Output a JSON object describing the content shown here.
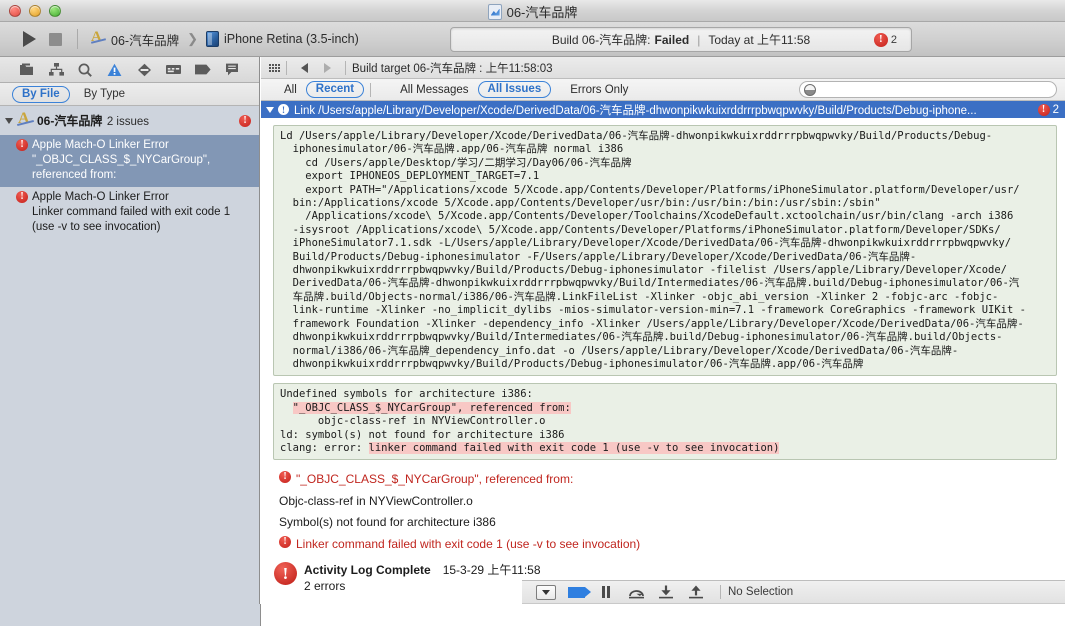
{
  "window": {
    "title": "06-汽车品牌",
    "traffic_lights": [
      "close-button",
      "minimize-button",
      "zoom-button"
    ]
  },
  "toolbar": {
    "run_label": "Run",
    "stop_label": "Stop",
    "scheme_name": "06-汽车品牌",
    "destination": "iPhone Retina (3.5-inch)",
    "status_prefix": "Build 06-汽车品牌:",
    "status_result": "Failed",
    "status_separator": "|",
    "status_time": "Today at 上午11:58",
    "error_count": "2"
  },
  "navigator": {
    "tabs": [
      {
        "name": "project-navigator",
        "selected": false
      },
      {
        "name": "symbol-navigator",
        "selected": false
      },
      {
        "name": "search-navigator",
        "selected": false
      },
      {
        "name": "issue-navigator",
        "selected": true
      },
      {
        "name": "test-navigator",
        "selected": false
      },
      {
        "name": "debug-navigator",
        "selected": false
      },
      {
        "name": "breakpoint-navigator",
        "selected": false
      },
      {
        "name": "log-navigator",
        "selected": false
      }
    ],
    "filter": {
      "by_file": "By File",
      "by_type": "By Type",
      "selected": "By File"
    },
    "group": {
      "title": "06-汽车品牌",
      "subtitle": "2 issues",
      "badge": "!"
    },
    "issues": [
      {
        "title": "Apple Mach-O Linker Error",
        "detail": "\"_OBJC_CLASS_$_NYCarGroup\", referenced from:",
        "selected": true,
        "badge": "!"
      },
      {
        "title": "Apple Mach-O Linker Error",
        "detail": "Linker command failed with exit code 1 (use -v to see invocation)",
        "selected": false,
        "badge": "!"
      }
    ]
  },
  "log": {
    "toolbar": {
      "grid_label": "Toggle Navigator",
      "back_label": "Back",
      "forward_label": "Forward",
      "breadcrumb": "Build target 06-汽车品牌 : 上午11:58:03"
    },
    "filters": {
      "all": "All",
      "recent": "Recent",
      "all_messages": "All Messages",
      "all_issues": "All Issues",
      "errors_only": "Errors Only",
      "selected_scope": "Recent",
      "selected_level": "All Issues"
    },
    "search_placeholder": "",
    "banner": {
      "label": "Link /Users/apple/Library/Developer/Xcode/DerivedData/06-汽车品牌-dhwonpikwkuixrddrrrpbwqpwvky/Build/Products/Debug-iphone...",
      "badge": "!",
      "count": "2"
    },
    "command_block": "Ld /Users/apple/Library/Developer/Xcode/DerivedData/06-汽车品牌-dhwonpikwkuixrddrrrpbwqpwvky/Build/Products/Debug-\n  iphonesimulator/06-汽车品牌.app/06-汽车品牌 normal i386\n    cd /Users/apple/Desktop/学习/二期学习/Day06/06-汽车品牌\n    export IPHONEOS_DEPLOYMENT_TARGET=7.1\n    export PATH=\"/Applications/xcode 5/Xcode.app/Contents/Developer/Platforms/iPhoneSimulator.platform/Developer/usr/\n  bin:/Applications/xcode 5/Xcode.app/Contents/Developer/usr/bin:/usr/bin:/bin:/usr/sbin:/sbin\"\n    /Applications/xcode\\ 5/Xcode.app/Contents/Developer/Toolchains/XcodeDefault.xctoolchain/usr/bin/clang -arch i386\n  -isysroot /Applications/xcode\\ 5/Xcode.app/Contents/Developer/Platforms/iPhoneSimulator.platform/Developer/SDKs/\n  iPhoneSimulator7.1.sdk -L/Users/apple/Library/Developer/Xcode/DerivedData/06-汽车品牌-dhwonpikwkuixrddrrrpbwqpwvky/\n  Build/Products/Debug-iphonesimulator -F/Users/apple/Library/Developer/Xcode/DerivedData/06-汽车品牌-\n  dhwonpikwkuixrddrrrpbwqpwvky/Build/Products/Debug-iphonesimulator -filelist /Users/apple/Library/Developer/Xcode/\n  DerivedData/06-汽车品牌-dhwonpikwkuixrddrrrpbwqpwvky/Build/Intermediates/06-汽车品牌.build/Debug-iphonesimulator/06-汽\n  车品牌.build/Objects-normal/i386/06-汽车品牌.LinkFileList -Xlinker -objc_abi_version -Xlinker 2 -fobjc-arc -fobjc-\n  link-runtime -Xlinker -no_implicit_dylibs -mios-simulator-version-min=7.1 -framework CoreGraphics -framework UIKit -\n  framework Foundation -Xlinker -dependency_info -Xlinker /Users/apple/Library/Developer/Xcode/DerivedData/06-汽车品牌-\n  dhwonpikwkuixrddrrrpbwqpwvky/Build/Intermediates/06-汽车品牌.build/Debug-iphonesimulator/06-汽车品牌.build/Objects-\n  normal/i386/06-汽车品牌_dependency_info.dat -o /Users/apple/Library/Developer/Xcode/DerivedData/06-汽车品牌-\n  dhwonpikwkuixrddrrrpbwqpwvky/Build/Products/Debug-iphonesimulator/06-汽车品牌.app/06-汽车品牌",
    "error_block": {
      "line1": "Undefined symbols for architecture i386:",
      "line2_hl": "\"_OBJC_CLASS_$_NYCarGroup\", referenced from:",
      "line3": "      objc-class-ref in NYViewController.o",
      "line4": "ld: symbol(s) not found for architecture i386",
      "line5_prefix": "clang: error: ",
      "line5_hl": "linker command failed with exit code 1 (use -v to see invocation)"
    },
    "issue_list": [
      {
        "text": "\"_OBJC_CLASS_$_NYCarGroup\", referenced from:",
        "badge": true,
        "red": true
      },
      {
        "text": "Objc-class-ref in NYViewController.o",
        "badge": false,
        "red": false
      },
      {
        "text": "Symbol(s) not found for architecture i386",
        "badge": false,
        "red": false
      },
      {
        "text": "Linker command failed with exit code 1 (use -v to see invocation)",
        "badge": true,
        "red": true
      }
    ],
    "summary": {
      "title": "Activity Log Complete",
      "time": "15-3-29 上午11:58",
      "subtitle": "2 errors",
      "badge": "!"
    }
  },
  "bottom_bar": {
    "buttons": [
      {
        "name": "scope-dropdown",
        "label": "Scope"
      },
      {
        "name": "continue-button",
        "label": "Continue"
      },
      {
        "name": "pause-button",
        "label": "Pause"
      },
      {
        "name": "step-over-button",
        "label": "Step Over"
      },
      {
        "name": "step-into-button",
        "label": "Step Into"
      },
      {
        "name": "step-out-button",
        "label": "Step Out"
      }
    ],
    "selection_label": "No Selection"
  },
  "colors": {
    "accent_blue": "#3b82d8",
    "banner_blue": "#3b6fc4",
    "error_red": "#c3201a",
    "code_bg": "#eaf0e6",
    "highlight_pink": "#f8c8c5",
    "navigator_bg": "#ced4dd",
    "selection_blue": "#8297b5"
  }
}
